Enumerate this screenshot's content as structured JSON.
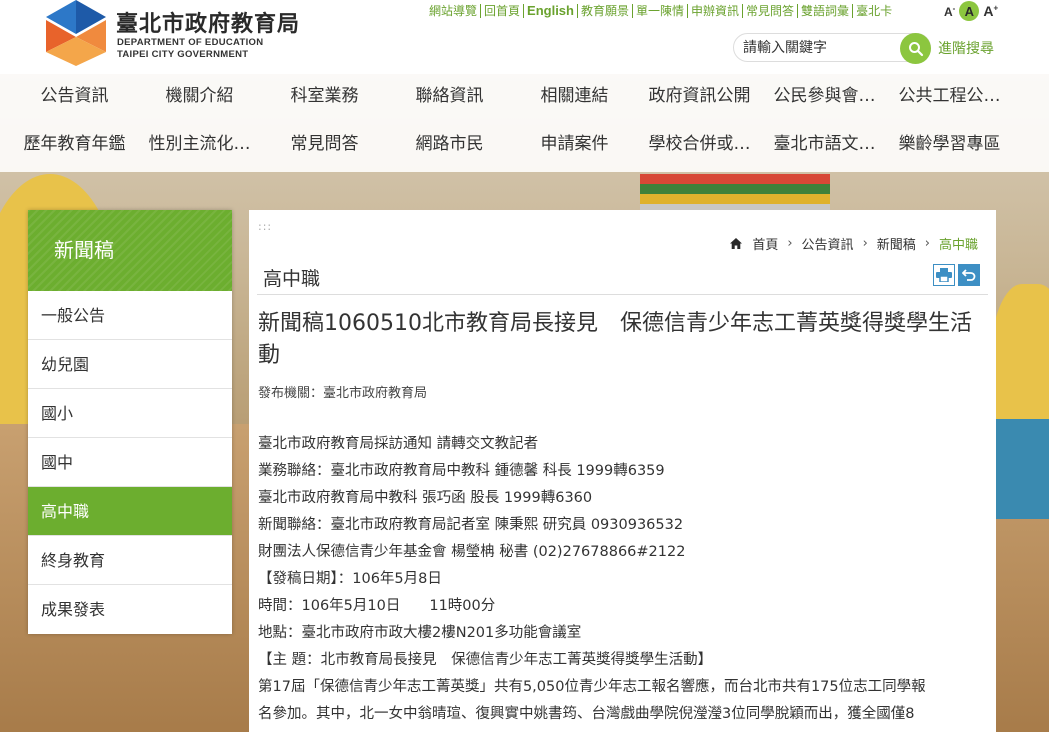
{
  "header": {
    "logo_zh": "臺北市政府教育局",
    "logo_en_line1": "DEPARTMENT OF EDUCATION",
    "logo_en_line2": "TAIPEI CITY GOVERNMENT",
    "top_links": [
      "網站導覽",
      "回首頁",
      "English",
      "教育願景",
      "單一陳情",
      "申辦資訊",
      "常見問答",
      "雙語詞彙",
      "臺北卡"
    ],
    "font_size": {
      "small": "A",
      "medium": "A",
      "large": "A",
      "minus": "-",
      "plus": "+"
    },
    "search_placeholder": "請輸入關鍵字",
    "advanced_search": "進階搜尋"
  },
  "menu": {
    "row1": [
      "公告資訊",
      "機關介紹",
      "科室業務",
      "聯絡資訊",
      "相關連結",
      "政府資訊公開",
      "公民參與會…",
      "公共工程公…"
    ],
    "row2": [
      "歷年教育年鑑",
      "性別主流化…",
      "常見問答",
      "網路市民",
      "申請案件",
      "學校合併或…",
      "臺北市語文…",
      "樂齡學習專區"
    ]
  },
  "sidebar": {
    "title": "新聞稿",
    "items": [
      "一般公告",
      "幼兒園",
      "國小",
      "國中",
      "高中職",
      "終身教育",
      "成果發表"
    ],
    "active_index": 4
  },
  "main": {
    "dots": ":::",
    "breadcrumb": [
      "首頁",
      "公告資訊",
      "新聞稿",
      "高中職"
    ],
    "section_title": "高中職",
    "article_title": "新聞稿1060510北市教育局長接見　保德信青少年志工菁英獎得獎學生活動",
    "publisher": "發布機關：臺北市政府教育局",
    "body": [
      "臺北市政府教育局採訪通知 請轉交文教記者",
      "業務聯絡：臺北市政府教育局中教科 鍾德馨 科長 1999轉6359",
      "臺北市政府教育局中教科 張巧函 股長 1999轉6360",
      "新聞聯絡：臺北市政府教育局記者室 陳秉熙 研究員 0930936532",
      "財團法人保德信青少年基金會 楊瑩柟 秘書 (02)27678866#2122",
      "【發稿日期】：106年5月8日",
      "時間：106年5月10日　　11時00分",
      "地點：臺北市政府市政大樓2樓N201多功能會議室",
      "【主 題：北市教育局長接見　保德信青少年志工菁英獎得獎學生活動】",
      "第17屆「保德信青少年志工菁英獎」共有5,050位青少年志工報名響應，而台北市共有175位志工同學報",
      "名參加。其中，北一女中翁晴瑄、復興實中姚書筠、台灣戲曲學院倪瀅瀅3位同學脫穎而出，獲全國僅8"
    ]
  },
  "colors": {
    "accent_green": "#6cae2f",
    "link_green": "#6aa22e",
    "icon_blue": "#3d8fc4"
  }
}
